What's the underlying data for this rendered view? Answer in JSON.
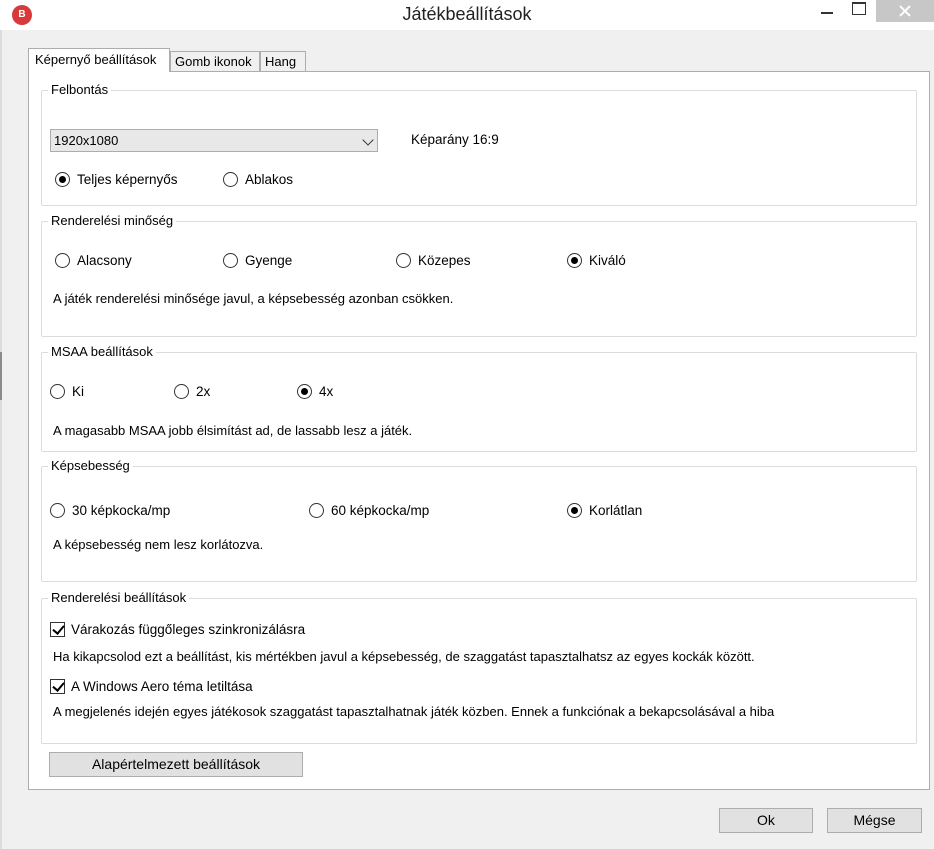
{
  "window": {
    "title": "Játékbeállítások",
    "app_icon_text": "B"
  },
  "tabs": [
    {
      "label": "Képernyő beállítások",
      "active": true
    },
    {
      "label": "Gomb ikonok",
      "active": false
    },
    {
      "label": "Hang",
      "active": false
    }
  ],
  "resolution": {
    "title": "Felbontás",
    "selected": "1920x1080",
    "aspect": "Képarány 16:9",
    "modes": [
      {
        "label": "Teljes képernyős",
        "checked": true
      },
      {
        "label": "Ablakos",
        "checked": false
      }
    ]
  },
  "render_quality": {
    "title": "Renderelési minőség",
    "options": [
      {
        "label": "Alacsony",
        "checked": false
      },
      {
        "label": "Gyenge",
        "checked": false
      },
      {
        "label": "Közepes",
        "checked": false
      },
      {
        "label": "Kiváló",
        "checked": true
      }
    ],
    "description": "A játék renderelési minősége javul, a képsebesség azonban csökken."
  },
  "msaa": {
    "title": "MSAA beállítások",
    "options": [
      {
        "label": "Ki",
        "checked": false
      },
      {
        "label": "2x",
        "checked": false
      },
      {
        "label": "4x",
        "checked": true
      }
    ],
    "description": "A magasabb MSAA jobb élsimítást ad, de lassabb lesz a játék."
  },
  "framerate": {
    "title": "Képsebesség",
    "options": [
      {
        "label": "30 képkocka/mp",
        "checked": false
      },
      {
        "label": "60 képkocka/mp",
        "checked": false
      },
      {
        "label": "Korlátlan",
        "checked": true
      }
    ],
    "description": "A képsebesség nem lesz korlátozva."
  },
  "render_settings": {
    "title": "Renderelési beállítások",
    "vsync": {
      "label": "Várakozás függőleges szinkronizálásra",
      "checked": true,
      "description": "Ha kikapcsolod ezt a beállítást, kis mértékben javul a képsebesség, de szaggatást tapasztalhatsz az egyes kockák között."
    },
    "aero": {
      "label": "A Windows Aero téma letiltása",
      "checked": true,
      "description": "A megjelenés idején egyes játékosok szaggatást tapasztalhatnak játék közben. Ennek a funkciónak a bekapcsolásával a hiba"
    }
  },
  "buttons": {
    "default": "Alapértelmezett beállítások",
    "ok": "Ok",
    "cancel": "Mégse"
  }
}
